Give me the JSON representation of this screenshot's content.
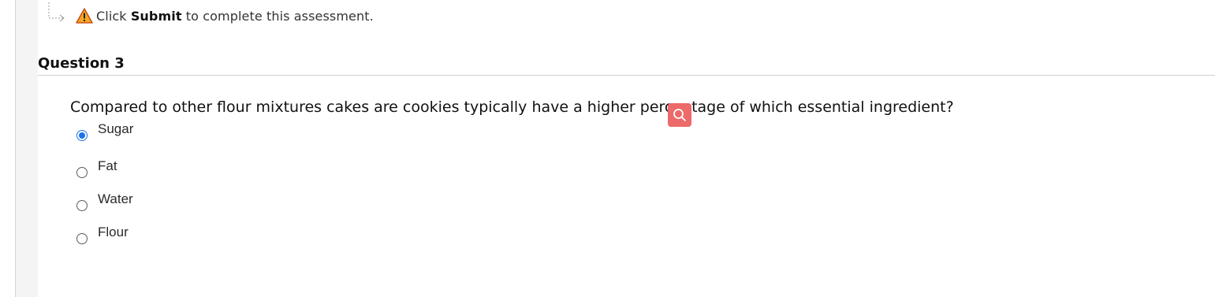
{
  "notice": {
    "prefix": "Click",
    "emphasis": "Submit",
    "suffix": "to complete this assessment."
  },
  "question": {
    "title": "Question 3",
    "text": "Compared to other flour mixtures cakes are cookies typically have a higher percentage of which essential ingredient?",
    "options": [
      {
        "label": "Sugar",
        "selected": true
      },
      {
        "label": "Fat",
        "selected": false
      },
      {
        "label": "Water",
        "selected": false
      },
      {
        "label": "Flour",
        "selected": false
      }
    ]
  },
  "colors": {
    "warning": "#f5a623",
    "lens_button": "#ec6a6a",
    "radio_selected": "#1a73e8"
  },
  "icons": {
    "arrow": "arrow-down-right-icon",
    "warning": "warning-icon",
    "lens": "search-icon"
  }
}
